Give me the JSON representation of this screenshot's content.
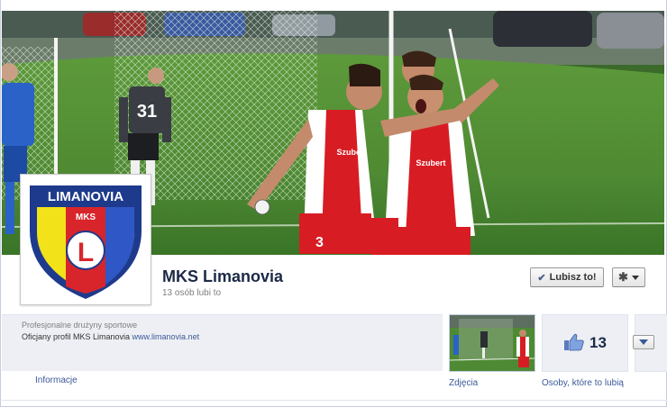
{
  "page": {
    "name": "MKS Limanovia",
    "likes_line": "13 osób lubi to",
    "category": "Profesjonalne drużyny sportowe",
    "description_text": "Oficjany profil MKS Limanovia ",
    "description_link": "www.limanovia.net"
  },
  "logo": {
    "text_top": "LIMANOVIA",
    "text_middle": "MKS",
    "letter": "L",
    "colors": {
      "navy": "#1e3a8c",
      "yellow": "#f2e21a",
      "red": "#d8252b",
      "blue": "#2f57c6"
    }
  },
  "cover": {
    "player_numbers": [
      "31",
      "3"
    ],
    "jersey_text": "Szubert"
  },
  "actions": {
    "like_button_label": "Lubisz to!",
    "like_icon": "check-icon",
    "settings_icon": "gear-icon"
  },
  "tabs": {
    "info_label": "Informacje",
    "photos_label": "Zdjęcia",
    "likes_label": "Osoby, które to lubią",
    "likes_count": "13",
    "likes_icon": "thumbs-up-icon"
  },
  "colors": {
    "link": "#3b5998",
    "name": "#1c2a47",
    "muted": "#7f7f7f",
    "panel": "#edeff4"
  }
}
